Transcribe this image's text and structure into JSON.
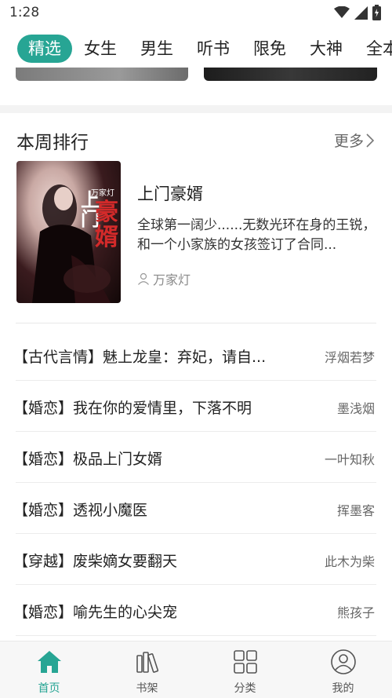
{
  "status": {
    "time": "1:28"
  },
  "tabs": [
    {
      "label": "精选",
      "active": true
    },
    {
      "label": "女生"
    },
    {
      "label": "男生"
    },
    {
      "label": "听书"
    },
    {
      "label": "限免"
    },
    {
      "label": "大神"
    },
    {
      "label": "全本"
    }
  ],
  "ranking": {
    "title": "本周排行",
    "more": "更多",
    "featured": {
      "title": "上门豪婿",
      "description": "全球第一阔少......无数光环在身的王锐，和一个小家族的女孩签订了合同...",
      "author": "万家灯",
      "cover_text": {
        "author": "万家灯",
        "title_part1": "上门",
        "title_part2": "豪婿"
      }
    },
    "items": [
      {
        "title": "【古代言情】魅上龙皇：弃妃，请自...",
        "author": "浮烟若梦"
      },
      {
        "title": "【婚恋】我在你的爱情里，下落不明",
        "author": "墨浅烟"
      },
      {
        "title": "【婚恋】极品上门女婿",
        "author": "一叶知秋"
      },
      {
        "title": "【婚恋】透视小魔医",
        "author": "挥墨客"
      },
      {
        "title": "【穿越】废柴嫡女要翻天",
        "author": "此木为柴"
      },
      {
        "title": "【婚恋】喻先生的心尖宠",
        "author": "熊孩子"
      }
    ]
  },
  "nav": {
    "items": [
      {
        "label": "首页",
        "icon": "home-icon",
        "active": true
      },
      {
        "label": "书架",
        "icon": "bookshelf-icon"
      },
      {
        "label": "分类",
        "icon": "category-icon"
      },
      {
        "label": "我的",
        "icon": "profile-icon"
      }
    ]
  },
  "colors": {
    "accent": "#27a594",
    "text": "#222222",
    "muted": "#8a8a8a"
  }
}
